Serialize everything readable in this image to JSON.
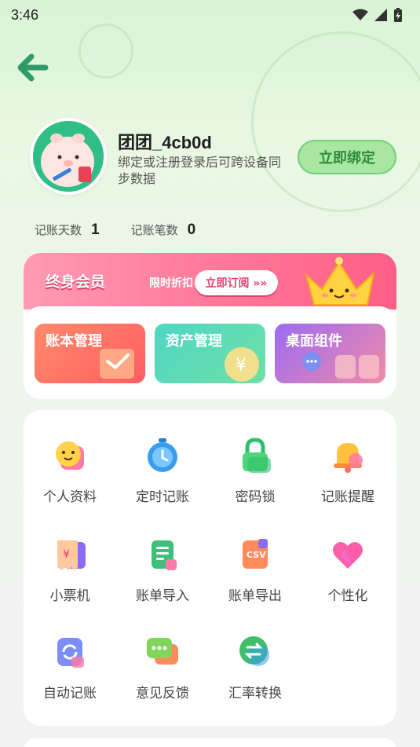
{
  "status_bar": {
    "time": "3:46"
  },
  "profile": {
    "name": "团团_4cb0d",
    "subtitle": "绑定或注册登录后可跨设备同步数据",
    "bind_button": "立即绑定"
  },
  "stats": [
    {
      "label": "记账天数",
      "value": "1"
    },
    {
      "label": "记账笔数",
      "value": "0"
    }
  ],
  "vip": {
    "title": "终身会员",
    "subtitle": "限时折扣",
    "subscribe_button": "立即订阅 »»",
    "tiles": [
      {
        "label": "账本管理",
        "color": "#ff7a5c"
      },
      {
        "label": "资产管理",
        "color": "#4fd6c4"
      },
      {
        "label": "桌面组件",
        "color": "#9b6cf2"
      }
    ]
  },
  "menu": {
    "items": [
      {
        "label": "个人资料",
        "icon": "smiley-icon"
      },
      {
        "label": "定时记账",
        "icon": "alarm-clock-icon"
      },
      {
        "label": "密码锁",
        "icon": "lock-icon"
      },
      {
        "label": "记账提醒",
        "icon": "bell-icon"
      },
      {
        "label": "小票机",
        "icon": "receipt-icon"
      },
      {
        "label": "账单导入",
        "icon": "bill-import-icon"
      },
      {
        "label": "账单导出",
        "icon": "csv-export-icon"
      },
      {
        "label": "个性化",
        "icon": "heart-icon"
      },
      {
        "label": "自动记账",
        "icon": "auto-refresh-icon"
      },
      {
        "label": "意见反馈",
        "icon": "chat-bubble-icon"
      },
      {
        "label": "汇率转换",
        "icon": "exchange-icon"
      }
    ]
  }
}
